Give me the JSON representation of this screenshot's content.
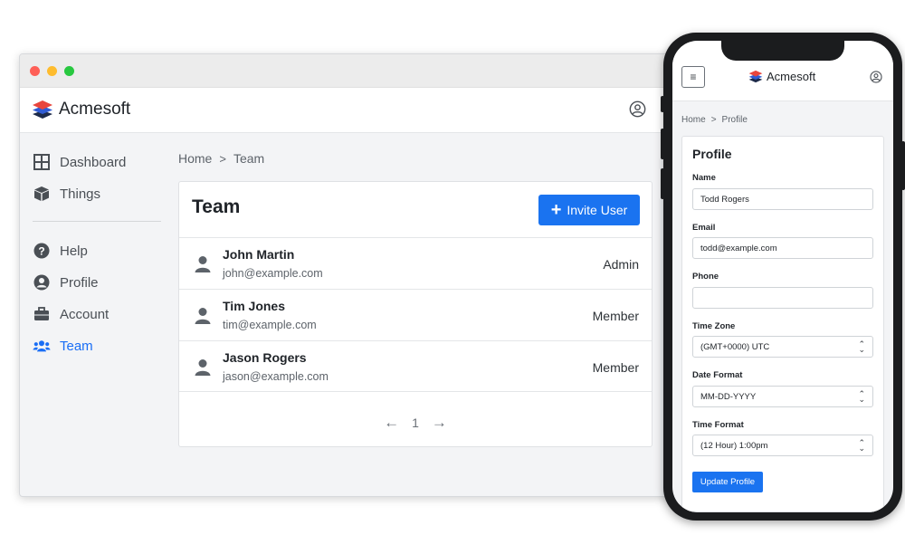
{
  "app": {
    "name": "Acmesoft"
  },
  "sidebar": {
    "items": [
      {
        "label": "Dashboard",
        "icon": "dashboard-icon"
      },
      {
        "label": "Things",
        "icon": "box-icon"
      },
      {
        "label": "Help",
        "icon": "help-icon"
      },
      {
        "label": "Profile",
        "icon": "profile-icon"
      },
      {
        "label": "Account",
        "icon": "briefcase-icon"
      },
      {
        "label": "Team",
        "icon": "users-icon",
        "active": true
      }
    ]
  },
  "desktop": {
    "breadcrumb": {
      "home": "Home",
      "separator": ">",
      "current": "Team"
    },
    "team": {
      "title": "Team",
      "invite_label": "Invite User",
      "members": [
        {
          "name": "John Martin",
          "email": "john@example.com",
          "role": "Admin"
        },
        {
          "name": "Tim Jones",
          "email": "tim@example.com",
          "role": "Member"
        },
        {
          "name": "Jason Rogers",
          "email": "jason@example.com",
          "role": "Member"
        }
      ],
      "pagination": {
        "prev": "←",
        "page": "1",
        "next": "→"
      }
    }
  },
  "mobile": {
    "menu_icon": "≡",
    "breadcrumb": {
      "home": "Home",
      "separator": ">",
      "current": "Profile"
    },
    "profile": {
      "title": "Profile",
      "name_label": "Name",
      "name_value": "Todd Rogers",
      "email_label": "Email",
      "email_value": "todd@example.com",
      "phone_label": "Phone",
      "phone_value": "",
      "timezone_label": "Time Zone",
      "timezone_value": "(GMT+0000) UTC",
      "dateformat_label": "Date Format",
      "dateformat_value": "MM-DD-YYYY",
      "timeformat_label": "Time Format",
      "timeformat_value": "(12 Hour) 1:00pm",
      "submit_label": "Update Profile"
    }
  },
  "colors": {
    "accent": "#1a73f0",
    "active_nav": "#1a6ef5",
    "logo_red": "#e8453c",
    "logo_blue": "#2f5bd3",
    "logo_dark": "#1c2a4a"
  }
}
